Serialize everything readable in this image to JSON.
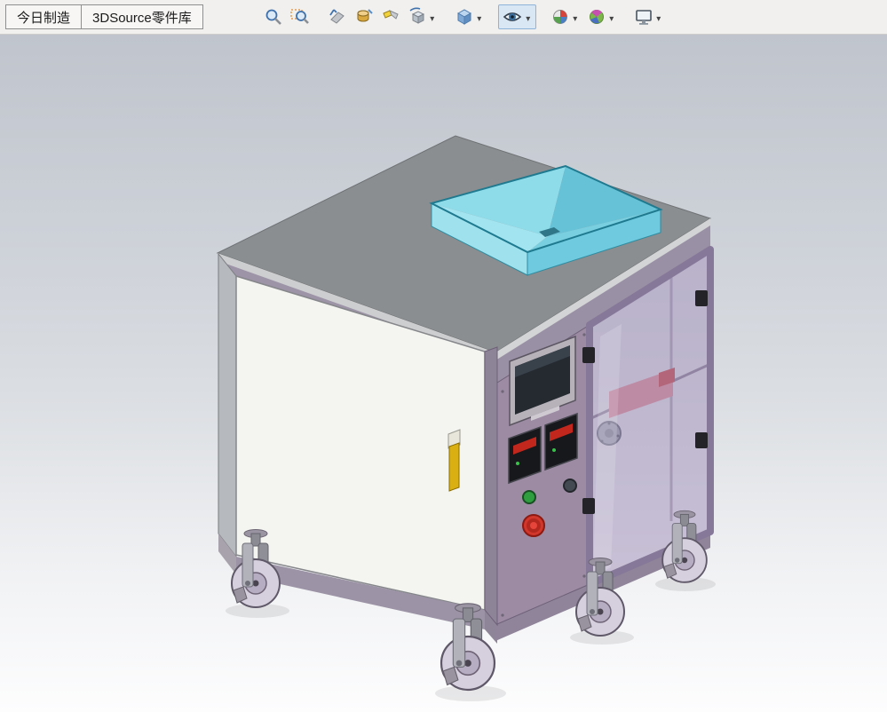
{
  "toolbar": {
    "tabs": [
      {
        "label": "今日制造"
      },
      {
        "label": "3DSource零件库"
      }
    ],
    "icons": [
      {
        "name": "zoom-to-fit",
        "dropdown": false,
        "active": false
      },
      {
        "name": "zoom-to-area",
        "dropdown": false,
        "active": false
      },
      {
        "name": "previous-view",
        "dropdown": false,
        "active": false
      },
      {
        "name": "section-view",
        "dropdown": false,
        "active": false
      },
      {
        "name": "annotation-views",
        "dropdown": false,
        "active": false
      },
      {
        "name": "view-orientation",
        "dropdown": true,
        "active": false
      },
      {
        "name": "display-style",
        "dropdown": true,
        "active": false
      },
      {
        "name": "hide-show-items",
        "dropdown": true,
        "active": true
      },
      {
        "name": "edit-appearance",
        "dropdown": true,
        "active": false
      },
      {
        "name": "apply-scene",
        "dropdown": true,
        "active": false
      },
      {
        "name": "view-settings",
        "dropdown": true,
        "active": false
      }
    ]
  },
  "viewport": {
    "description": "3D isometric view of a wheeled machine cabinet with cyan top hopper, white side door, purple control panel with HMI screen, two temperature controllers, start/stop buttons, emergency stop, and a transparent purple glass door on four swivel casters"
  },
  "colors": {
    "bg_top": "#c0c5cd",
    "bg_mid": "#dcdfe3",
    "bg_bottom": "#fdfdfe",
    "accent_active": "#d9e7f5",
    "top_slab": "#8b8e90",
    "hopper_light": "#9fe2ee",
    "hopper_mid": "#6fcadf",
    "panel_white": "#f4f4f1",
    "frame_purple": "#9a90a5",
    "control_panel": "#9c8ba3",
    "glass": "#9b86b6",
    "estop_red": "#d2372b",
    "handle_yellow": "#d9af12",
    "wheel": "#d6d0de"
  }
}
